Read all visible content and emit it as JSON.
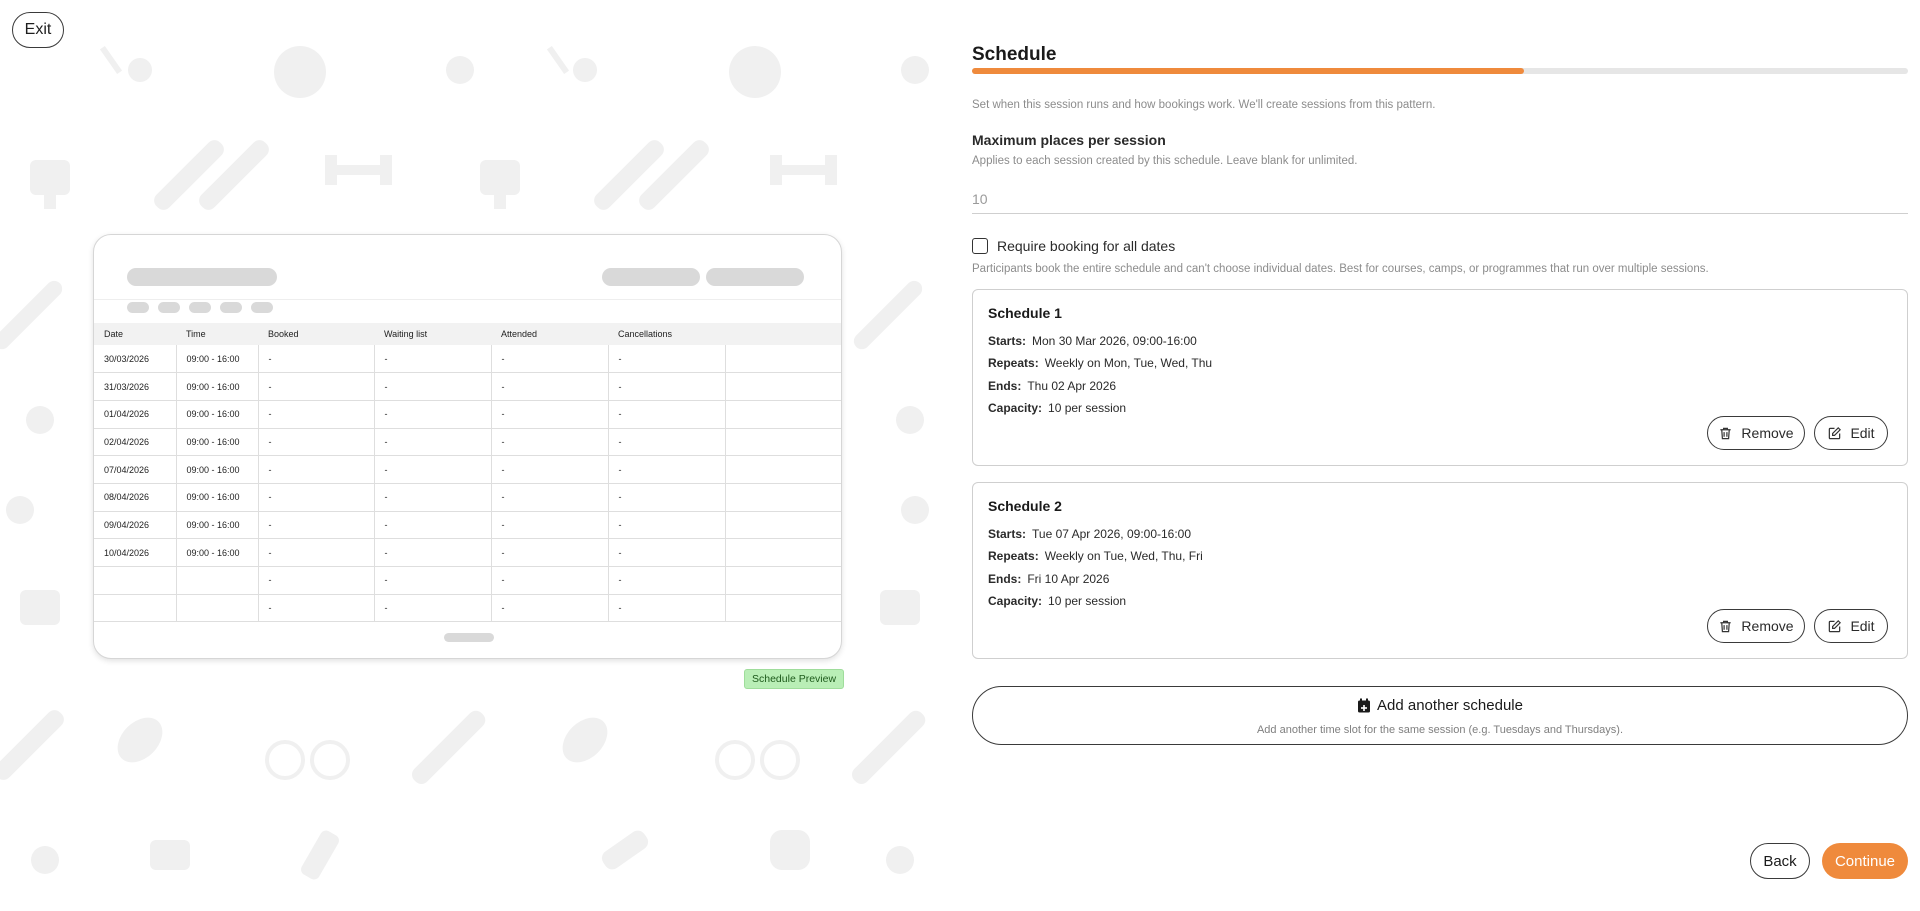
{
  "exit_label": "Exit",
  "preview": {
    "badge": "Schedule Preview",
    "columns": [
      "Date",
      "Time",
      "Booked",
      "Waiting list",
      "Attended",
      "Cancellations",
      ""
    ],
    "rows": [
      [
        "30/03/2026",
        "09:00 - 16:00",
        "-",
        "-",
        "-",
        "-",
        ""
      ],
      [
        "31/03/2026",
        "09:00 - 16:00",
        "-",
        "-",
        "-",
        "-",
        ""
      ],
      [
        "01/04/2026",
        "09:00 - 16:00",
        "-",
        "-",
        "-",
        "-",
        ""
      ],
      [
        "02/04/2026",
        "09:00 - 16:00",
        "-",
        "-",
        "-",
        "-",
        ""
      ],
      [
        "07/04/2026",
        "09:00 - 16:00",
        "-",
        "-",
        "-",
        "-",
        ""
      ],
      [
        "08/04/2026",
        "09:00 - 16:00",
        "-",
        "-",
        "-",
        "-",
        ""
      ],
      [
        "09/04/2026",
        "09:00 - 16:00",
        "-",
        "-",
        "-",
        "-",
        ""
      ],
      [
        "10/04/2026",
        "09:00 - 16:00",
        "-",
        "-",
        "-",
        "-",
        ""
      ],
      [
        "",
        "",
        "-",
        "-",
        "-",
        "-",
        ""
      ],
      [
        "",
        "",
        "-",
        "-",
        "-",
        "-",
        ""
      ]
    ]
  },
  "form": {
    "title": "Schedule",
    "progress_percent": 59,
    "intro": "Set when this session runs and how bookings work. We'll create sessions from this pattern.",
    "max_places": {
      "label": "Maximum places per session",
      "hint": "Applies to each session created by this schedule. Leave blank for unlimited.",
      "placeholder": "10",
      "value": ""
    },
    "require_booking": {
      "label": "Require booking for all dates",
      "hint": "Participants book the entire schedule and can't choose individual dates. Best for courses, camps, or programmes that run over multiple sessions.",
      "checked": false
    },
    "schedules": [
      {
        "title": "Schedule 1",
        "starts_label": "Starts:",
        "starts": "Mon 30 Mar 2026, 09:00-16:00",
        "repeats_label": "Repeats:",
        "repeats": "Weekly on Mon, Tue, Wed, Thu",
        "ends_label": "Ends:",
        "ends": "Thu 02 Apr 2026",
        "capacity_label": "Capacity:",
        "capacity": "10 per session",
        "remove_label": "Remove",
        "edit_label": "Edit"
      },
      {
        "title": "Schedule 2",
        "starts_label": "Starts:",
        "starts": "Tue 07 Apr 2026, 09:00-16:00",
        "repeats_label": "Repeats:",
        "repeats": "Weekly on Tue, Wed, Thu, Fri",
        "ends_label": "Ends:",
        "ends": "Fri 10 Apr 2026",
        "capacity_label": "Capacity:",
        "capacity": "10 per session",
        "remove_label": "Remove",
        "edit_label": "Edit"
      }
    ],
    "add_schedule": {
      "label": "Add another schedule",
      "hint": "Add another time slot for the same session (e.g. Tuesdays and Thursdays)."
    },
    "back_label": "Back",
    "continue_label": "Continue",
    "accent_color": "#ef8a3c"
  }
}
